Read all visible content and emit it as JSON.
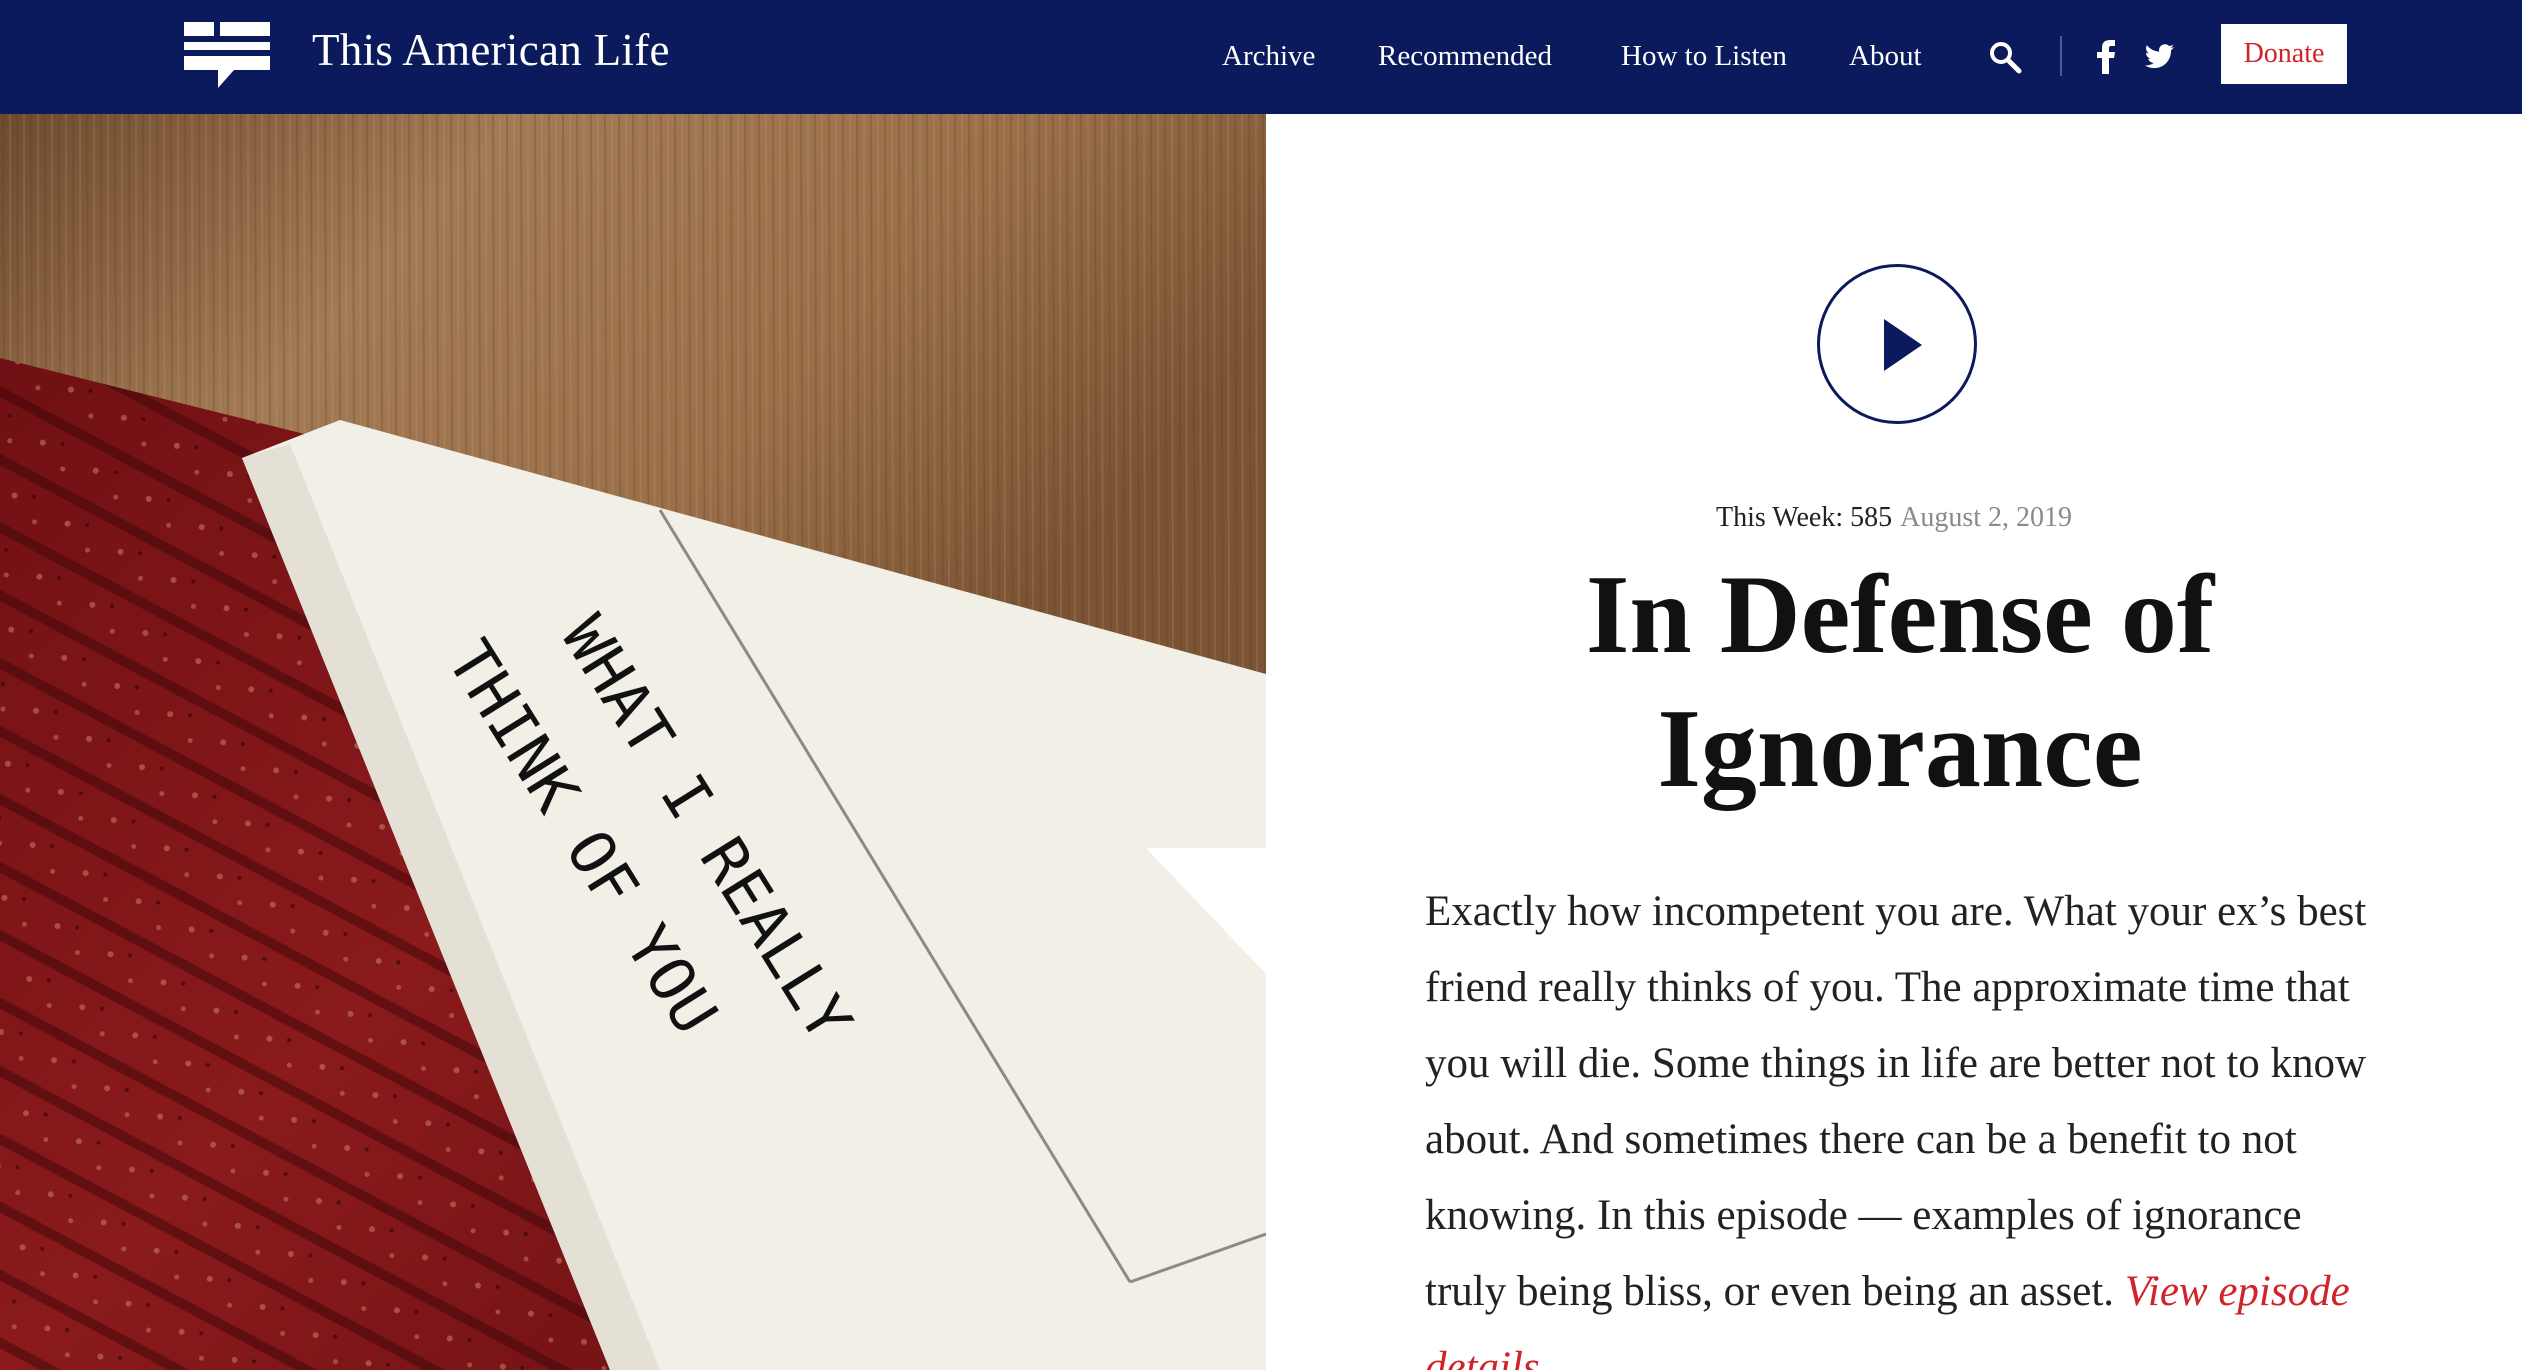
{
  "header": {
    "site_title": "This American Life",
    "nav": [
      "Archive",
      "Recommended",
      "How to Listen",
      "About"
    ],
    "donate_label": "Donate",
    "icons": [
      "logo-icon",
      "search-icon",
      "facebook-icon",
      "twitter-icon"
    ],
    "colors": {
      "navy": "#0a1a5c",
      "red": "#d1232a"
    }
  },
  "hero": {
    "envelope_text_line1": "WHAT I REALLY",
    "envelope_text_line2": "THINK OF YOU"
  },
  "episode": {
    "week_label": "This Week: 585",
    "date": "August 2, 2019",
    "title": "In Defense of Ignorance",
    "description": "Exactly how incompetent you are. What your ex’s best friend really thinks of you. The approximate time that you will die. Some things in life are better not to know about. And sometimes there can be a benefit to not knowing. In this episode — examples of ignorance truly being bliss, or even being an asset.",
    "details_link": "View episode details."
  }
}
